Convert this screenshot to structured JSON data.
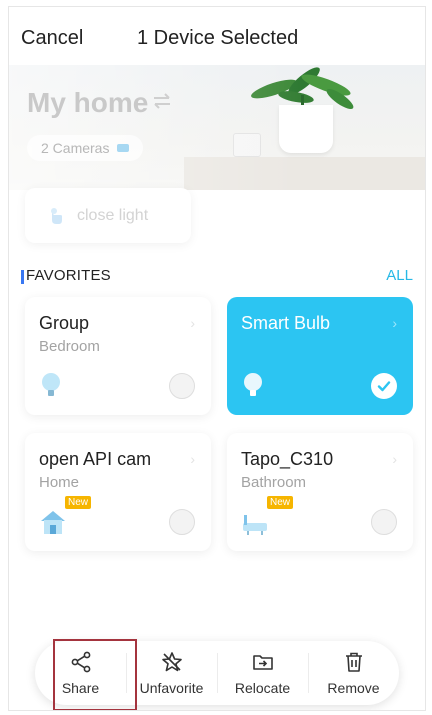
{
  "header": {
    "cancel_label": "Cancel",
    "title": "1 Device Selected"
  },
  "home": {
    "name": "My home",
    "cameras_label": "2 Cameras"
  },
  "scene": {
    "label": "close light"
  },
  "favorites": {
    "title": "FAVORITES",
    "all_label": "ALL"
  },
  "devices": [
    {
      "name": "Group",
      "room": "Bedroom",
      "icon": "bulb-icon",
      "selected": false,
      "new_badge": ""
    },
    {
      "name": "Smart Bulb",
      "room": "",
      "icon": "bulb-icon",
      "selected": true,
      "new_badge": ""
    },
    {
      "name": "open API cam",
      "room": "Home",
      "icon": "house-camera-icon",
      "selected": false,
      "new_badge": "New"
    },
    {
      "name": "Tapo_C310",
      "room": "Bathroom",
      "icon": "bathroom-camera-icon",
      "selected": false,
      "new_badge": "New"
    }
  ],
  "actions": [
    {
      "label": "Share",
      "icon": "share-icon"
    },
    {
      "label": "Unfavorite",
      "icon": "unfavorite-star-icon"
    },
    {
      "label": "Relocate",
      "icon": "relocate-icon"
    },
    {
      "label": "Remove",
      "icon": "trash-icon"
    }
  ],
  "colors": {
    "accent": "#2cc5f2",
    "highlight_border": "#a4343e",
    "favorites_bar": "#3877f2"
  }
}
